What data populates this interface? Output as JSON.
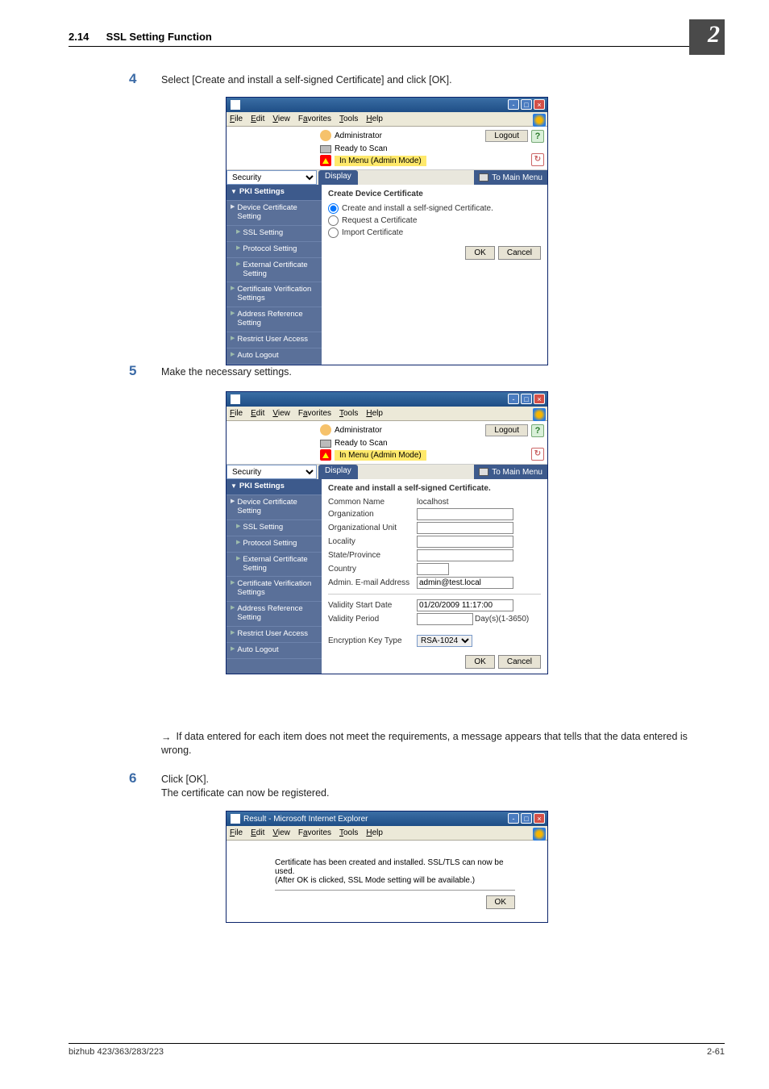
{
  "header": {
    "secnum": "2.14",
    "sectitle": "SSL Setting Function",
    "pageflag": "2"
  },
  "steps": {
    "s4": {
      "num": "4",
      "text": "Select [Create and install a self-signed Certificate] and click [OK]."
    },
    "s5": {
      "num": "5",
      "text": "Make the necessary settings."
    },
    "note": "If data entered for each item does not meet the requirements, a message appears that tells that the data entered is wrong.",
    "s6": {
      "num": "6",
      "text1": "Click [OK].",
      "text2": "The certificate can now be registered."
    }
  },
  "menubar": {
    "file": "File",
    "edit": "Edit",
    "view": "View",
    "favorites": "Favorites",
    "tools": "Tools",
    "help": "Help"
  },
  "panel": {
    "admin": "Administrator",
    "logout": "Logout",
    "ready": "Ready to Scan",
    "mode": "In Menu (Admin Mode)",
    "security": "Security",
    "display": "Display",
    "tomain": "To Main Menu",
    "help": "?"
  },
  "side": {
    "pki": "PKI Settings",
    "dcs": "Device Certificate Setting",
    "ssl": "SSL Setting",
    "proto": "Protocol Setting",
    "ext": "External Certificate Setting",
    "certver": "Certificate Verification Settings",
    "addr": "Address Reference Setting",
    "rest": "Restrict User Access",
    "auto": "Auto Logout"
  },
  "create": {
    "title": "Create Device Certificate",
    "opt1": "Create and install a self-signed Certificate.",
    "opt2": "Request a Certificate",
    "opt3": "Import Certificate",
    "ok": "OK",
    "cancel": "Cancel"
  },
  "form": {
    "title": "Create and install a self-signed Certificate.",
    "common": "Common Name",
    "common_v": "localhost",
    "org": "Organization",
    "ou": "Organizational Unit",
    "loc": "Locality",
    "state": "State/Province",
    "country": "Country",
    "email": "Admin. E-mail Address",
    "email_v": "admin@test.local",
    "start": "Validity Start Date",
    "start_v": "01/20/2009 11:17:00",
    "period": "Validity Period",
    "period_v": "",
    "period_hint": "Day(s)(1-3650)",
    "enc": "Encryption Key Type",
    "enc_v": "RSA-1024"
  },
  "result": {
    "title": "Result - Microsoft Internet Explorer",
    "msg1": "Certificate has been created and installed. SSL/TLS can now be used.",
    "msg2": "(After OK is clicked, SSL Mode setting will be available.)",
    "ok": "OK"
  },
  "footer": {
    "model": "bizhub 423/363/283/223",
    "page": "2-61"
  }
}
